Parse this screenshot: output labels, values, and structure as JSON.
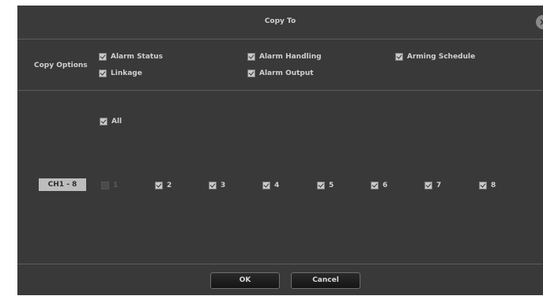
{
  "dialog": {
    "title": "Copy To",
    "close_icon": "close-icon"
  },
  "copy_options": {
    "label": "Copy Options",
    "items": [
      {
        "label": "Alarm Status",
        "checked": true
      },
      {
        "label": "Alarm Handling",
        "checked": true
      },
      {
        "label": "Arming Schedule",
        "checked": true
      },
      {
        "label": "Linkage",
        "checked": true
      },
      {
        "label": "Alarm Output",
        "checked": true
      }
    ]
  },
  "channels": {
    "all_label": "All",
    "group_button": "CH1 - 8",
    "items": [
      {
        "label": "1",
        "checked": false,
        "disabled": true
      },
      {
        "label": "2",
        "checked": true
      },
      {
        "label": "3",
        "checked": true
      },
      {
        "label": "4",
        "checked": true
      },
      {
        "label": "5",
        "checked": true
      },
      {
        "label": "6",
        "checked": true
      },
      {
        "label": "7",
        "checked": true
      },
      {
        "label": "8",
        "checked": true
      }
    ]
  },
  "footer": {
    "ok_label": "OK",
    "cancel_label": "Cancel"
  }
}
